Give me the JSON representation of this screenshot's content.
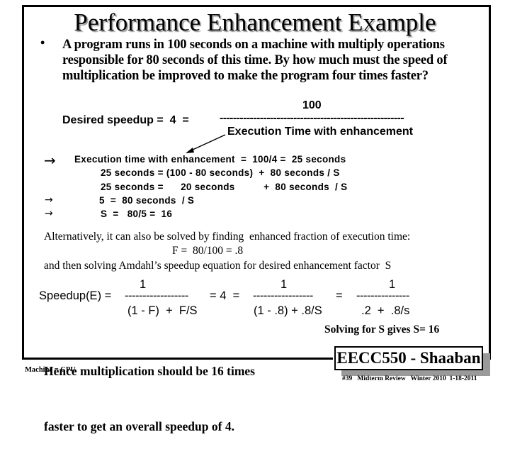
{
  "slide": {
    "title": "Performance Enhancement Example",
    "bullet_glyph": "•",
    "problem_text": "A program runs in 100 seconds on a machine with multiply operations responsible for 80 seconds of this time.   By how much must the speed of multiplication be improved to make the program four times faster?",
    "desired_speedup": {
      "label": "Desired speedup =  4  =",
      "numerator": "100",
      "divider": "-------------------------------------------------------",
      "denominator": "Execution Time with enhancement"
    },
    "steps": [
      {
        "arrow": "→",
        "text": "Execution time with enhancement  =  100/4 =  25 seconds"
      },
      {
        "arrow": "",
        "text": "25 seconds = (100 - 80 seconds)  +  80 seconds / S"
      },
      {
        "arrow": "",
        "text": "25 seconds =      20 seconds          +  80 seconds  / S"
      },
      {
        "arrow": "→",
        "text": "5  =  80 seconds  / S"
      },
      {
        "arrow": "→",
        "text": "S  =   80/5 =  16"
      }
    ],
    "alternative": {
      "line1": "Alternatively, it can also be solved by finding  enhanced fraction of execution time:",
      "line2": "F =  80/100 = .8",
      "line3": "and then solving Amdahl’s speedup equation for desired enhancement factor  S"
    },
    "amdahl": {
      "label": "Speedup(E) =",
      "frac1_num": "1",
      "frac1_div": "------------------",
      "frac1_den": "(1 - F)  +  F/S",
      "eq_mid": "= 4  =",
      "frac2_num": "1",
      "frac2_div": "-----------------",
      "frac2_den": "(1 - .8) + .8/S",
      "eq_end": "=",
      "frac3_num": "1",
      "frac3_div": "---------------",
      "frac3_den": ".2  +  .8/s"
    },
    "conclusion_line1": "Hence multiplication should be 16 times",
    "conclusion_line2": "faster to get an overall speedup of 4.",
    "solving_note": "Solving for S gives S= 16",
    "footer": {
      "badge": "EECC550 - Shaaban",
      "machine_note": "Machine = CPU",
      "slide_info": "#39   Midterm Review   Winter 2010  1-18-2011"
    }
  }
}
